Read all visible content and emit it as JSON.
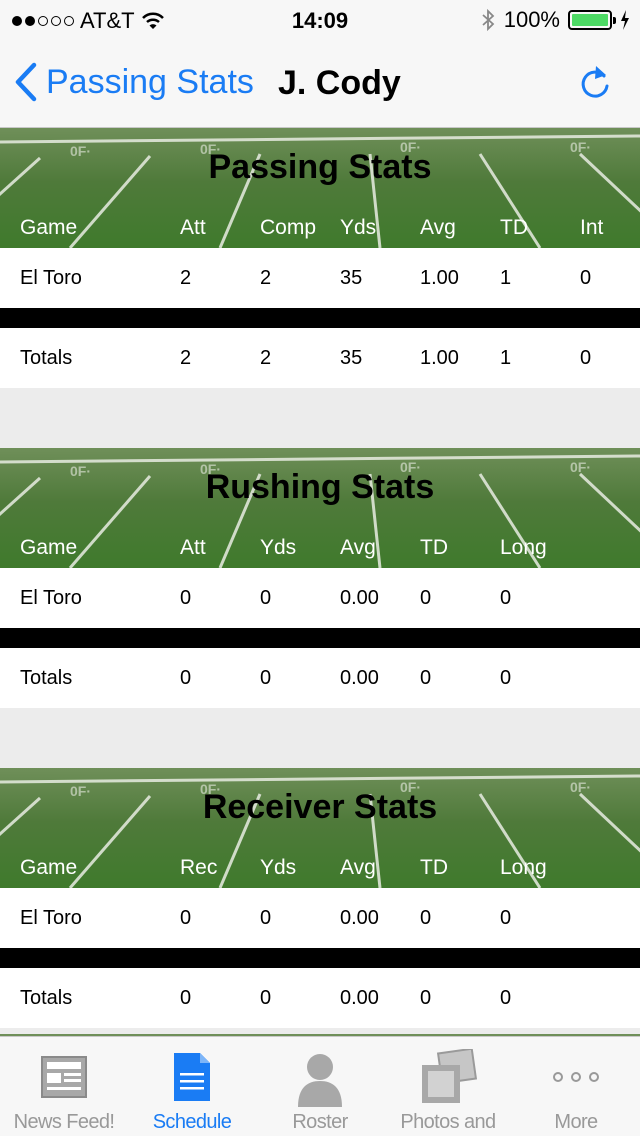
{
  "status_bar": {
    "carrier": "AT&T",
    "time": "14:09",
    "battery": "100%"
  },
  "nav": {
    "back_label": "Passing Stats",
    "title": "J. Cody"
  },
  "sections": {
    "passing": {
      "title": "Passing Stats",
      "headers": [
        "Game",
        "Att",
        "Comp",
        "Yds",
        "Avg",
        "TD",
        "Int"
      ],
      "rows": [
        [
          "El Toro",
          "2",
          "2",
          "35",
          "1.00",
          "1",
          "0"
        ]
      ],
      "totals": [
        "Totals",
        "2",
        "2",
        "35",
        "1.00",
        "1",
        "0"
      ]
    },
    "rushing": {
      "title": "Rushing Stats",
      "headers": [
        "Game",
        "Att",
        "Yds",
        "Avg",
        "TD",
        "Long"
      ],
      "rows": [
        [
          "El Toro",
          "0",
          "0",
          "0.00",
          "0",
          "0"
        ]
      ],
      "totals": [
        "Totals",
        "0",
        "0",
        "0.00",
        "0",
        "0"
      ]
    },
    "receiver": {
      "title": "Receiver Stats",
      "headers": [
        "Game",
        "Rec",
        "Yds",
        "Avg",
        "TD",
        "Long"
      ],
      "rows": [
        [
          "El Toro",
          "0",
          "0",
          "0.00",
          "0",
          "0"
        ]
      ],
      "totals": [
        "Totals",
        "0",
        "0",
        "0.00",
        "0",
        "0"
      ]
    }
  },
  "tabs": [
    {
      "label": "News Feed!",
      "icon": "newspaper-icon"
    },
    {
      "label": "Schedule",
      "icon": "document-icon",
      "active": true
    },
    {
      "label": "Roster",
      "icon": "person-icon"
    },
    {
      "label": "Photos and Videos",
      "icon": "photos-icon"
    },
    {
      "label": "More",
      "icon": "more-dots-icon"
    }
  ],
  "colors": {
    "accent": "#1a7cf4",
    "field_green": "#4f7a3a",
    "battery": "#4cd964"
  }
}
